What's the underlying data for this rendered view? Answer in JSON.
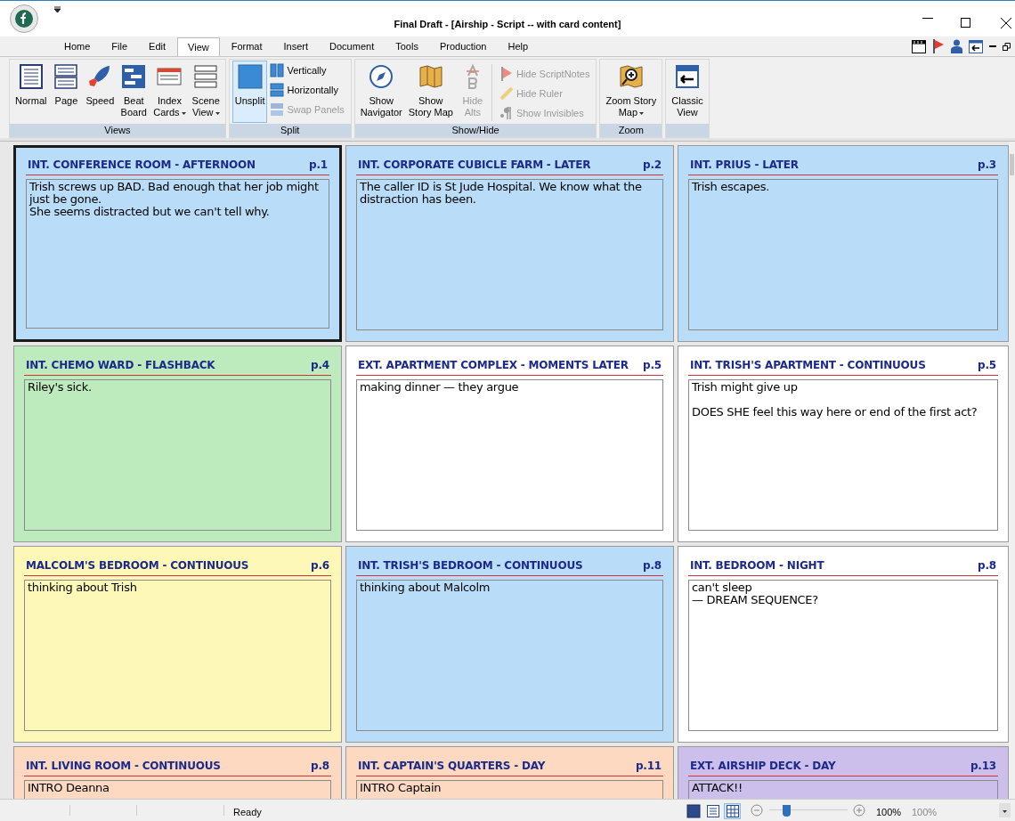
{
  "window": {
    "title": "Final Draft - [Airship - Script -- with card content]"
  },
  "menu_tabs": [
    {
      "label": "Home",
      "selected": false
    },
    {
      "label": "File",
      "selected": false
    },
    {
      "label": "Edit",
      "selected": false
    },
    {
      "label": "View",
      "selected": true
    },
    {
      "label": "Format",
      "selected": false
    },
    {
      "label": "Insert",
      "selected": false
    },
    {
      "label": "Document",
      "selected": false
    },
    {
      "label": "Tools",
      "selected": false
    },
    {
      "label": "Production",
      "selected": false
    },
    {
      "label": "Help",
      "selected": false
    }
  ],
  "ribbon": [
    {
      "title": "Views",
      "buttons": [
        {
          "lines": [
            "Normal"
          ],
          "dropdown": false
        },
        {
          "lines": [
            "Page"
          ],
          "dropdown": false
        },
        {
          "lines": [
            "Speed"
          ],
          "dropdown": false
        },
        {
          "lines": [
            "Beat",
            "Board"
          ],
          "dropdown": false
        },
        {
          "lines": [
            "Index",
            "Cards"
          ],
          "dropdown": true
        },
        {
          "lines": [
            "Scene",
            "View"
          ],
          "dropdown": true
        }
      ]
    },
    {
      "title": "Split",
      "buttons": [
        {
          "lines": [
            "Unsplit"
          ],
          "dropdown": false,
          "selected": true
        }
      ],
      "small_buttons": [
        {
          "label": "Vertically",
          "disabled": false
        },
        {
          "label": "Horizontally",
          "disabled": false
        },
        {
          "label": "Swap Panels",
          "disabled": true
        }
      ]
    },
    {
      "title": "Show/Hide",
      "buttons": [
        {
          "lines": [
            "Show",
            "Navigator"
          ],
          "dropdown": false
        },
        {
          "lines": [
            "Show",
            "Story Map"
          ],
          "dropdown": false
        },
        {
          "lines": [
            "Hide",
            "Alts"
          ],
          "dropdown": false,
          "disabled": true
        }
      ],
      "small_buttons": [
        {
          "label": "Hide ScriptNotes",
          "disabled": true
        },
        {
          "label": "Hide Ruler",
          "disabled": true
        },
        {
          "label": "Show Invisibles",
          "disabled": true
        }
      ]
    },
    {
      "title": "Zoom",
      "buttons": [
        {
          "lines": [
            "Zoom Story",
            "Map"
          ],
          "dropdown": true
        }
      ]
    },
    {
      "buttons": [
        {
          "lines": [
            "Classic",
            "View"
          ],
          "dropdown": false
        }
      ]
    }
  ],
  "cards": [
    {
      "heading": "INT. CONFERENCE ROOM - AFTERNOON",
      "page": "p.1",
      "text": "Trish screws up BAD. Bad enough that her job might just be gone.\nShe seems distracted but we can't tell why.",
      "color": "#b9ddf8",
      "selected": true
    },
    {
      "heading": "INT. CORPORATE CUBICLE FARM - LATER",
      "page": "p.2",
      "text": "The caller ID is St Jude Hospital. We know what the distraction has been.",
      "color": "#b9ddf8",
      "selected": false
    },
    {
      "heading": "INT. PRIUS - LATER",
      "page": "p.3",
      "text": "Trish escapes.",
      "color": "#b9ddf8",
      "selected": false
    },
    {
      "heading": "INT. CHEMO WARD - FLASHBACK",
      "page": "p.4",
      "text": "Riley's sick.",
      "color": "#bdebbd",
      "selected": false
    },
    {
      "heading": "EXT. APARTMENT COMPLEX - MOMENTS LATER",
      "page": "p.5",
      "text": "making dinner — they argue",
      "color": "#ffffff",
      "selected": false
    },
    {
      "heading": "INT. TRISH'S APARTMENT - CONTINUOUS",
      "page": "p.5",
      "text": "Trish might give up\n\nDOES SHE feel this way here or end of the first act?",
      "color": "#ffffff",
      "selected": false
    },
    {
      "heading": "MALCOLM'S BEDROOM - CONTINUOUS",
      "page": "p.6",
      "text": "thinking about Trish",
      "color": "#fdf8b8",
      "selected": false
    },
    {
      "heading": "INT. TRISH'S BEDROOM - CONTINUOUS",
      "page": "p.8",
      "text": "thinking about Malcolm",
      "color": "#b9ddf8",
      "selected": false
    },
    {
      "heading": "INT. BEDROOM - NIGHT",
      "page": "p.8",
      "text": "can't sleep\n— DREAM SEQUENCE?",
      "color": "#ffffff",
      "selected": false
    },
    {
      "heading": "INT. LIVING ROOM - CONTINUOUS",
      "page": "p.8",
      "text": "INTRO Deanna",
      "color": "#fdd9c1",
      "selected": false
    },
    {
      "heading": "INT. CAPTAIN'S QUARTERS - DAY",
      "page": "p.11",
      "text": "INTRO Captain",
      "color": "#fdd9c1",
      "selected": false
    },
    {
      "heading": "EXT. AIRSHIP DECK - DAY",
      "page": "p.13",
      "text": "ATTACK!!",
      "color": "#cdbfec",
      "selected": false
    }
  ],
  "status_bar": {
    "message": "Ready",
    "view_buttons": [
      {
        "selected": false
      },
      {
        "selected": false
      },
      {
        "selected": true
      }
    ],
    "zoom_slider": {
      "level": 0.22
    },
    "zoom": "100%",
    "zoom_secondary": "100%"
  }
}
